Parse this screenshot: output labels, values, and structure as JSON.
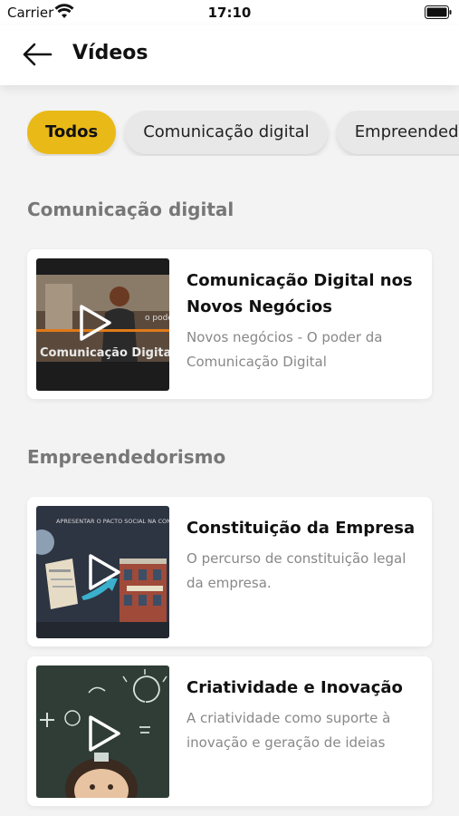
{
  "status_bar": {
    "carrier": "Carrier",
    "time": "17:10"
  },
  "header": {
    "title": "Vídeos"
  },
  "chips": [
    {
      "label": "Todos",
      "active": true
    },
    {
      "label": "Comunicação digital",
      "active": false
    },
    {
      "label": "Empreendedorismo",
      "active": false
    }
  ],
  "sections": [
    {
      "title": "Comunicação digital",
      "videos": [
        {
          "title": "Comunicação Digital nos Novos Negócios",
          "description": "Novos negócios - O poder da Comunicação Digital",
          "thumb_text": "Comunicação Digital",
          "thumb_small": "o pode"
        }
      ]
    },
    {
      "title": "Empreendedorismo",
      "videos": [
        {
          "title": "Constituição da Empresa",
          "description": "O percurso de constituição legal da empresa.",
          "thumb_text": "APRESENTAR O PACTO SOCIAL NA CONSERVATÓRIA"
        },
        {
          "title": "Criatividade e Inovação",
          "description": "A criatividade como suporte à inovação e geração de ideias"
        }
      ]
    }
  ],
  "colors": {
    "accent": "#e9b918",
    "background": "#f3f3f3"
  },
  "icons": [
    "wifi-icon",
    "battery-icon",
    "back-arrow-icon",
    "play-icon"
  ]
}
